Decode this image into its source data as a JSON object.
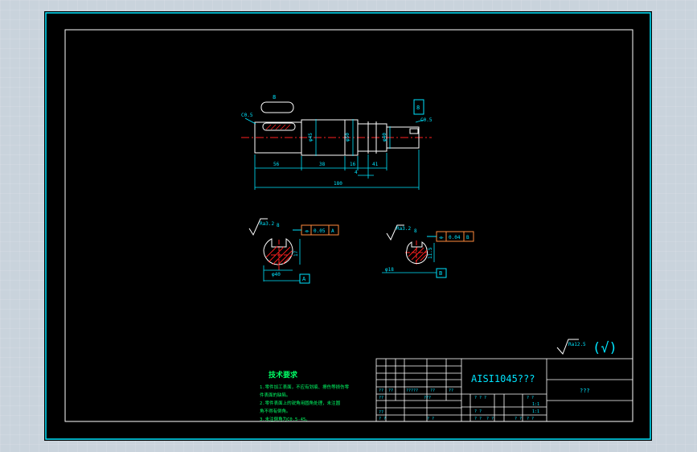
{
  "colors": {
    "background": "#000000",
    "border": "#00e5ff",
    "inner_frame": "#ffffff",
    "dimension": "#00e5ff",
    "outline": "#ffffff",
    "centerline": "#ff2020",
    "tolerance_box": "#ff8a3d",
    "notes": "#00ff66",
    "section_hatch": "#ff2020"
  },
  "main_view": {
    "keyway_label": "8",
    "chamfer_left": "C0.5",
    "chamfer_right": "C0.5",
    "right_key_label": "8",
    "diameters": [
      "φ45",
      "φ50",
      "φ40"
    ],
    "lengths": [
      "56",
      "38",
      "16",
      "41",
      "4"
    ],
    "total_length": "180"
  },
  "section_1": {
    "roughness": "Ra3.2",
    "width_label": "8",
    "tolerance": "0.05",
    "datum_ref": "A",
    "depth_label": "17",
    "diameter_label": "φ40",
    "datum_label": "A"
  },
  "section_2": {
    "roughness": "Ra3.2",
    "width_label": "8",
    "tolerance": "0.04",
    "datum_ref": "B",
    "depth_label": "11.5",
    "diameter_label": "φ18",
    "datum_label": "B"
  },
  "surface_finish": {
    "label": "Ra12.5",
    "note": "(√)"
  },
  "title_block": {
    "material": "AISI1045???",
    "drawing_name": "???",
    "small_cells": [
      "??",
      "??",
      "?????",
      "??",
      "??",
      "??",
      "??",
      "???",
      "? ? ?",
      "? ?",
      "? ?",
      "? ?",
      "? ?",
      "1:1",
      "? ?",
      "? ?",
      "1:1",
      "? ?",
      "? ?"
    ]
  },
  "notes": {
    "title": "技术要求",
    "lines": [
      "1.零件加工表面，不应有划痕、擦伤等损伤零",
      "件表面的缺陷。",
      "2.零件表面上的锐角用圆角处理，未注圆",
      "角不得有倒角。",
      "3.未注倒角为C0.5-45。"
    ]
  }
}
